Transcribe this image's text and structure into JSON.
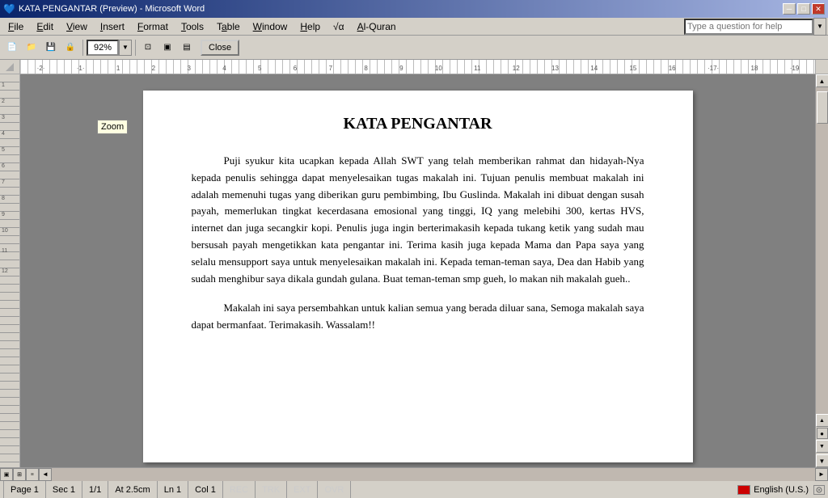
{
  "titlebar": {
    "title": "KATA PENGANTAR (Preview) - Microsoft Word",
    "min_btn": "─",
    "max_btn": "□",
    "close_btn": "✕"
  },
  "menubar": {
    "items": [
      {
        "id": "file",
        "label": "File",
        "underline_pos": 0
      },
      {
        "id": "edit",
        "label": "Edit",
        "underline_pos": 0
      },
      {
        "id": "view",
        "label": "View",
        "underline_pos": 0
      },
      {
        "id": "insert",
        "label": "Insert",
        "underline_pos": 0
      },
      {
        "id": "format",
        "label": "Format",
        "underline_pos": 0
      },
      {
        "id": "tools",
        "label": "Tools",
        "underline_pos": 0
      },
      {
        "id": "table",
        "label": "Table",
        "underline_pos": 0
      },
      {
        "id": "window",
        "label": "Window",
        "underline_pos": 0
      },
      {
        "id": "help",
        "label": "Help",
        "underline_pos": 0
      },
      {
        "id": "formula",
        "label": "√α",
        "underline_pos": -1
      },
      {
        "id": "alquran",
        "label": "Al-Quran",
        "underline_pos": 0
      }
    ]
  },
  "toolbar": {
    "zoom_value": "92%",
    "zoom_placeholder": "92%",
    "close_label": "Close",
    "question_placeholder": "Type a question for help"
  },
  "ruler": {
    "tooltip": "Zoom"
  },
  "document": {
    "title": "KATA PENGANTAR",
    "paragraphs": [
      "Puji syukur kita ucapkan kepada Allah SWT yang telah memberikan rahmat dan hidayah-Nya kepada penulis sehingga dapat menyelesaikan tugas makalah ini. Tujuan penulis membuat makalah ini adalah memenuhi tugas yang diberikan guru pembimbing, Ibu Guslinda. Makalah ini dibuat dengan susah payah, memerlukan tingkat kecerdasana emosional yang tinggi, IQ yang melebihi 300, kertas HVS, internet dan juga secangkir kopi. Penulis juga ingin berterimakasih kepada tukang ketik yang sudah mau bersusah payah mengetikkan kata pengantar ini. Terima kasih juga kepada Mama dan Papa saya yang selalu mensupport saya untuk menyelesaikan makalah ini. Kepada teman-teman saya, Dea dan Habib yang sudah menghibur saya dikala gundah gulana. Buat teman-teman smp gueh, lo makan nih makalah gueh..",
      "Makalah ini saya persembahkan untuk kalian semua yang berada diluar sana, Semoga makalah saya dapat bermanfaat. Terimakasih. Wassalam!!"
    ]
  },
  "statusbar": {
    "page": "Page 1",
    "sec": "Sec 1",
    "page_count": "1/1",
    "position": "At 2.5cm",
    "line": "Ln 1",
    "col": "Col 1",
    "rec": "REC",
    "trk": "TRK",
    "ext": "EXT",
    "ovr": "OVR",
    "language": "English (U.S.)"
  }
}
